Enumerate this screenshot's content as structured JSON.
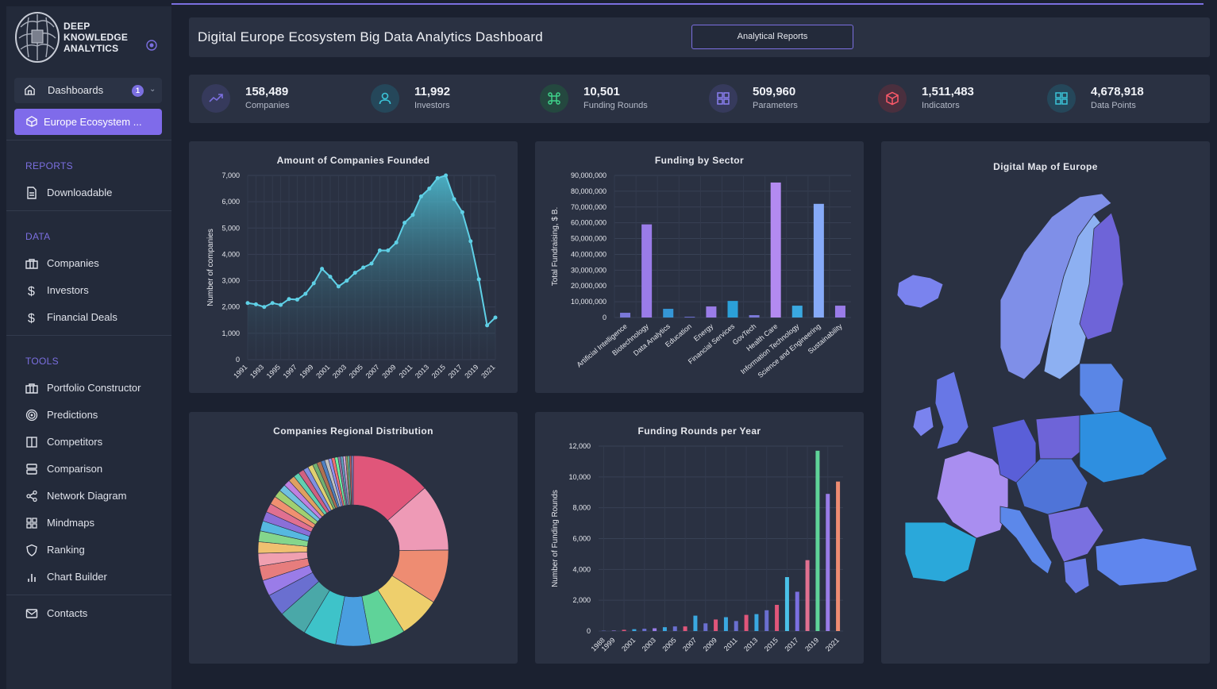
{
  "brand": {
    "line1": "DEEP",
    "line2": "KNOWLEDGE",
    "line3": "ANALYTICS"
  },
  "sidebar": {
    "dashboards": {
      "label": "Dashboards",
      "badge": "1"
    },
    "active_item": "Europe Ecosystem ...",
    "sections": [
      {
        "title": "REPORTS",
        "items": [
          {
            "label": "Downloadable",
            "icon": "document-icon"
          }
        ]
      },
      {
        "title": "DATA",
        "items": [
          {
            "label": "Companies",
            "icon": "briefcase-icon"
          },
          {
            "label": "Investors",
            "icon": "dollar-icon"
          },
          {
            "label": "Financial Deals",
            "icon": "dollar-icon"
          }
        ]
      },
      {
        "title": "TOOLS",
        "items": [
          {
            "label": "Portfolio Constructor",
            "icon": "briefcase-icon"
          },
          {
            "label": "Predictions",
            "icon": "target-icon"
          },
          {
            "label": "Competitors",
            "icon": "columns-icon"
          },
          {
            "label": "Comparison",
            "icon": "server-icon"
          },
          {
            "label": "Network Diagram",
            "icon": "share-icon"
          },
          {
            "label": "Mindmaps",
            "icon": "grid-icon"
          },
          {
            "label": "Ranking",
            "icon": "shield-icon"
          },
          {
            "label": "Chart Builder",
            "icon": "bar-chart-icon"
          }
        ]
      }
    ],
    "contacts": "Contacts"
  },
  "header": {
    "title": "Digital Europe Ecosystem Big Data Analytics Dashboard",
    "button": "Analytical Reports"
  },
  "stats": [
    {
      "value": "158,489",
      "label": "Companies",
      "icon": "trending-up-icon",
      "color": "#7b6fe0",
      "bg": "#363a5c"
    },
    {
      "value": "11,992",
      "label": "Investors",
      "icon": "user-icon",
      "color": "#3bc4d8",
      "bg": "#25475a"
    },
    {
      "value": "10,501",
      "label": "Funding Rounds",
      "icon": "command-icon",
      "color": "#3fd08a",
      "bg": "#24483f"
    },
    {
      "value": "509,960",
      "label": "Parameters",
      "icon": "grid-icon",
      "color": "#8a7ff0",
      "bg": "#363a5c"
    },
    {
      "value": "1,511,483",
      "label": "Indicators",
      "icon": "box-icon",
      "color": "#ff5a6a",
      "bg": "#4a2f3e"
    },
    {
      "value": "4,678,918",
      "label": "Data Points",
      "icon": "grid-icon",
      "color": "#3bc4d8",
      "bg": "#25475a"
    }
  ],
  "cards": {
    "companies_founded": "Amount of Companies Founded",
    "funding_sector": "Funding by Sector",
    "map": "Digital Map of Europe",
    "regional": "Companies Regional Distribution",
    "rounds_year": "Funding Rounds per Year"
  },
  "chart_data": [
    {
      "type": "area",
      "title": "Amount of Companies Founded",
      "ylabel": "Number of companies",
      "ylim": [
        0,
        7000
      ],
      "yticks": [
        "0",
        "1,000",
        "2,000",
        "3,000",
        "4,000",
        "5,000",
        "6,000",
        "7,000"
      ],
      "xtick_labels": [
        "1991",
        "1993",
        "1995",
        "1997",
        "1999",
        "2001",
        "2003",
        "2005",
        "2007",
        "2009",
        "2011",
        "2013",
        "2015",
        "2017",
        "2019",
        "2021"
      ],
      "x": [
        1991,
        1992,
        1993,
        1994,
        1995,
        1996,
        1997,
        1998,
        1999,
        2000,
        2001,
        2002,
        2003,
        2004,
        2005,
        2006,
        2007,
        2008,
        2009,
        2010,
        2011,
        2012,
        2013,
        2014,
        2015,
        2016,
        2017,
        2018,
        2019,
        2020,
        2021
      ],
      "values": [
        2150,
        2100,
        2000,
        2150,
        2080,
        2300,
        2280,
        2500,
        2900,
        3450,
        3150,
        2780,
        3000,
        3300,
        3500,
        3650,
        4150,
        4150,
        4450,
        5200,
        5500,
        6200,
        6500,
        6900,
        7000,
        6100,
        5600,
        4500,
        3050,
        1300,
        1600
      ]
    },
    {
      "type": "bar",
      "title": "Funding by Sector",
      "ylabel": "Total Fundraising, $ B.",
      "ylim": [
        0,
        90000000
      ],
      "yticks": [
        "0",
        "10,000,000",
        "20,000,000",
        "30,000,000",
        "40,000,000",
        "50,000,000",
        "60,000,000",
        "70,000,000",
        "80,000,000",
        "90,000,000"
      ],
      "categories": [
        "Artificial Intelligence",
        "Biotechnology",
        "Data Analytics",
        "Education",
        "Energy",
        "Financial Services",
        "GovTech",
        "Health Care",
        "Information Technology",
        "Science and Engineering",
        "Sustainability"
      ],
      "values": [
        3000000,
        59000000,
        5500000,
        500000,
        7000000,
        10500000,
        1500000,
        85500000,
        7500000,
        72000000,
        7500000
      ],
      "colors": [
        "#7b79d8",
        "#9a7ce8",
        "#3596d6",
        "#6a6fd0",
        "#9a7ce8",
        "#2ba0d8",
        "#7b79d8",
        "#b38af0",
        "#3aa8e0",
        "#86aaf8",
        "#9a7ce8"
      ]
    },
    {
      "type": "pie",
      "title": "Companies Regional Distribution",
      "values": [
        12.5,
        10.5,
        8.5,
        6.5,
        5.5,
        5.5,
        5.2,
        4.5,
        3.5,
        2.5,
        2.3,
        2.0,
        1.8,
        1.7,
        1.6,
        1.5,
        1.4,
        1.3,
        1.2,
        1.1,
        1.0,
        1.0,
        0.9,
        0.9,
        0.8,
        0.8,
        0.7,
        0.7,
        0.6,
        0.6,
        0.5,
        0.5,
        0.5,
        0.4,
        0.4,
        0.4,
        0.3,
        0.3,
        0.3,
        0.3
      ],
      "colors": [
        "#e0567a",
        "#ee9ab6",
        "#ee8c72",
        "#eecf6c",
        "#5fd399",
        "#4a9ee0",
        "#3ec3c9",
        "#4aa8a8",
        "#6a6fd0",
        "#9a7ce8",
        "#e77d7d",
        "#f0a0b0",
        "#f0c070",
        "#84d68c",
        "#56b8e0",
        "#8b6fd8",
        "#e07090",
        "#f09070",
        "#a0d070",
        "#70c0e0",
        "#c080e0",
        "#e0a060",
        "#60d0b0",
        "#d06080",
        "#8090e0",
        "#e0d070",
        "#70b070",
        "#b07050",
        "#5080c0",
        "#c0c0c0",
        "#9090f0",
        "#f07070",
        "#70f0a0",
        "#a070a0",
        "#60a0c0",
        "#d0a0d0",
        "#a0a060",
        "#60c0a0",
        "#c06060",
        "#8080c0"
      ]
    },
    {
      "type": "bar",
      "title": "Funding Rounds per Year",
      "ylabel": "Number of Funding Rounds",
      "ylim": [
        0,
        12000
      ],
      "yticks": [
        "0",
        "2,000",
        "4,000",
        "6,000",
        "8,000",
        "10,000",
        "12,000"
      ],
      "xtick_labels": [
        "1988",
        "1999",
        "2001",
        "2003",
        "2005",
        "2007",
        "2009",
        "2011",
        "2013",
        "2015",
        "2017",
        "2019",
        "2021"
      ],
      "x": [
        1988,
        1999,
        2000,
        2001,
        2002,
        2003,
        2004,
        2005,
        2006,
        2007,
        2008,
        2009,
        2010,
        2011,
        2012,
        2013,
        2014,
        2015,
        2016,
        2017,
        2018,
        2019,
        2020,
        2021
      ],
      "values": [
        20,
        30,
        80,
        120,
        150,
        180,
        250,
        300,
        300,
        1000,
        500,
        750,
        900,
        650,
        1050,
        1100,
        1350,
        1700,
        3500,
        2550,
        4600,
        11700,
        8900,
        9700
      ],
      "colors": [
        "#6a6fd0",
        "#9a7ce8",
        "#e0567a",
        "#3aa8e0",
        "#6a6fd0",
        "#9a7ce8",
        "#3aa8e0",
        "#6a6fd0",
        "#e0567a",
        "#3aa8e0",
        "#6a6fd0",
        "#e0567a",
        "#3aa8e0",
        "#6a6fd0",
        "#e0567a",
        "#3aa8e0",
        "#6a6fd0",
        "#e0567a",
        "#4ac1e8",
        "#7b6fe0",
        "#e07090",
        "#5fd399",
        "#9a7ce8",
        "#ee8c72"
      ]
    }
  ]
}
